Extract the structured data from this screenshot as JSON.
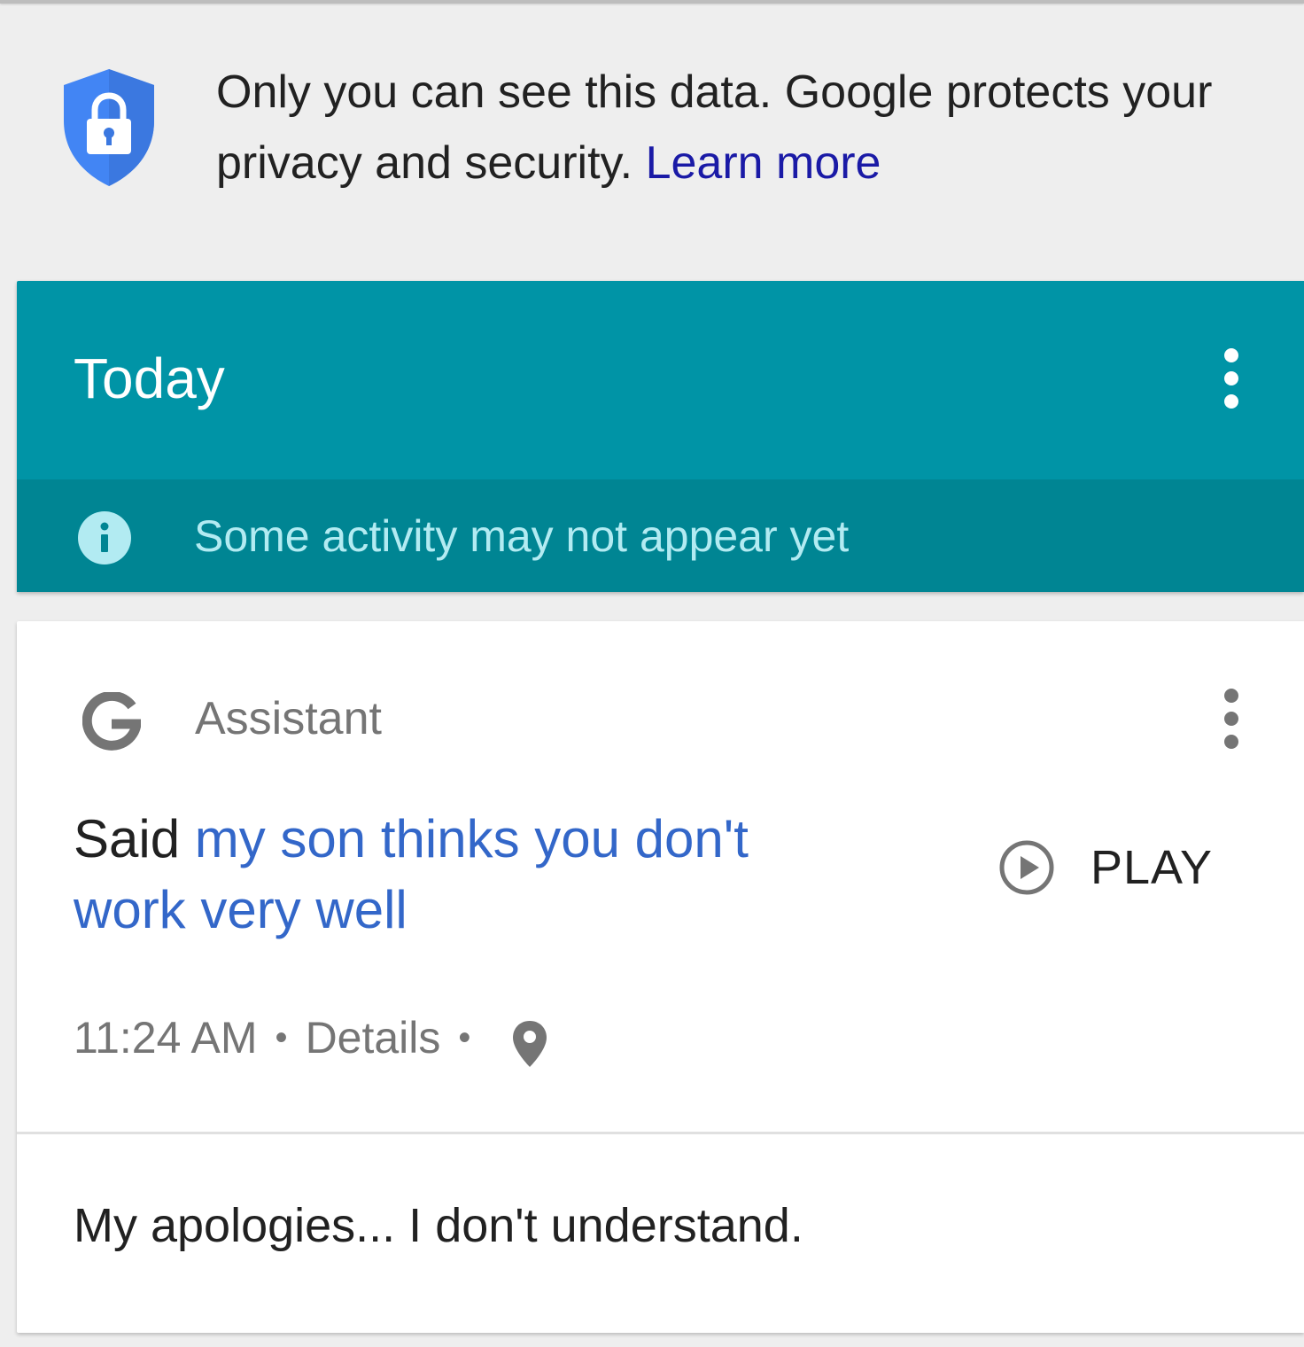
{
  "privacy": {
    "text": "Only you can see this data. Google protects your privacy and security.",
    "link_label": "Learn more",
    "icon": "shield-lock-icon"
  },
  "today": {
    "title": "Today",
    "notice": "Some activity may not appear yet",
    "notice_icon": "info-icon",
    "menu_icon": "more-vert-icon"
  },
  "activity": {
    "product": "Assistant",
    "product_icon": "google-g-icon",
    "query_prefix": "Said",
    "query": "my son thinks you don't work very well",
    "play_label": "PLAY",
    "time": "11:24 AM",
    "separator": "•",
    "details_label": "Details",
    "location_icon": "location-pin-icon",
    "response": "My apologies... I don't understand."
  },
  "colors": {
    "background": "#eeeeee",
    "today_header": "#0094a6",
    "notice_bar": "#008593",
    "notice_text": "#b2ebf2",
    "query_blue": "#3367c9",
    "link_blue": "#1a1aa6",
    "shield_blue": "#4285f4"
  }
}
